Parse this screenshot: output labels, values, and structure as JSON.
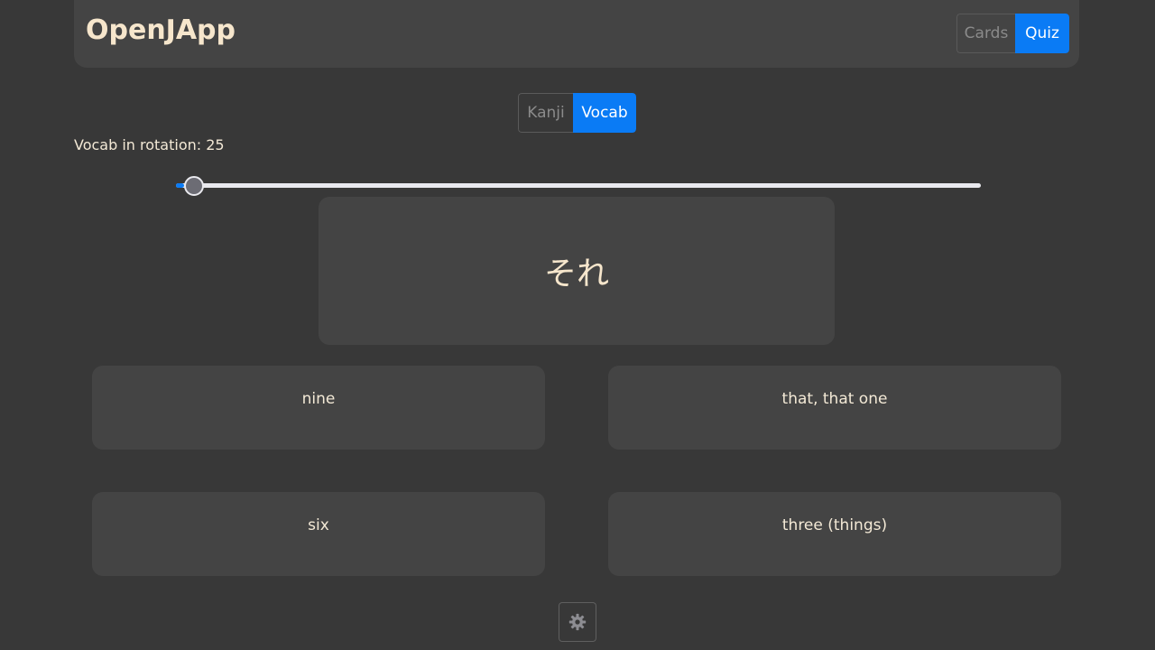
{
  "app": {
    "title": "OpenJApp"
  },
  "mode_toggle": {
    "options": [
      "Cards",
      "Quiz"
    ],
    "selected": "Quiz"
  },
  "type_toggle": {
    "options": [
      "Kanji",
      "Vocab"
    ],
    "selected": "Vocab"
  },
  "rotation": {
    "label": "Vocab in rotation: 25",
    "slider_value_fraction": 0.01
  },
  "quiz": {
    "prompt": "それ",
    "answers": [
      "nine",
      "that, that one",
      "six",
      "three (things)"
    ]
  },
  "settings": {
    "icon": "gear-icon"
  },
  "colors": {
    "background": "#383838",
    "panel": "#444444",
    "accent": "#0a7bf5",
    "text": "#f3e9d6"
  }
}
